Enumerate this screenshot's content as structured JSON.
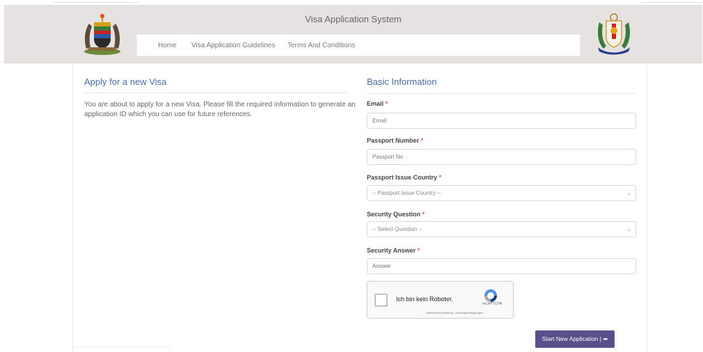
{
  "header": {
    "title": "Visa Application System",
    "nav": [
      {
        "label": "Home"
      },
      {
        "label": "Visa Application Guidelines"
      },
      {
        "label": "Terms And Conditions"
      }
    ]
  },
  "intro": {
    "heading": "Apply for a new Visa",
    "text": "You are about to apply for a new Visa. Please fill the required information to generate an application ID which you can use for future references."
  },
  "form": {
    "heading": "Basic Information",
    "required_marker": "*",
    "email": {
      "label": "Email",
      "placeholder": "Email"
    },
    "passport_number": {
      "label": "Passport Number",
      "placeholder": "Passport No"
    },
    "passport_country": {
      "label": "Passport Issue Country",
      "selected": "-- Passport Issue Country --"
    },
    "security_question": {
      "label": "Security Question",
      "selected": "-- Select Question --"
    },
    "security_answer": {
      "label": "Security Answer",
      "placeholder": "Answer"
    },
    "captcha": {
      "label": "Ich bin kein Roboter.",
      "brand": "reCAPTCHA",
      "terms": "Datenschutzerklärung - Nutzungsbedingungen"
    },
    "submit_label": "Start New Application |",
    "submit_icon": "share-arrow-icon"
  },
  "colors": {
    "accent": "#4a6fa5",
    "button": "#57508a",
    "required": "#d9534f",
    "header_bg": "#e6e2e2"
  }
}
